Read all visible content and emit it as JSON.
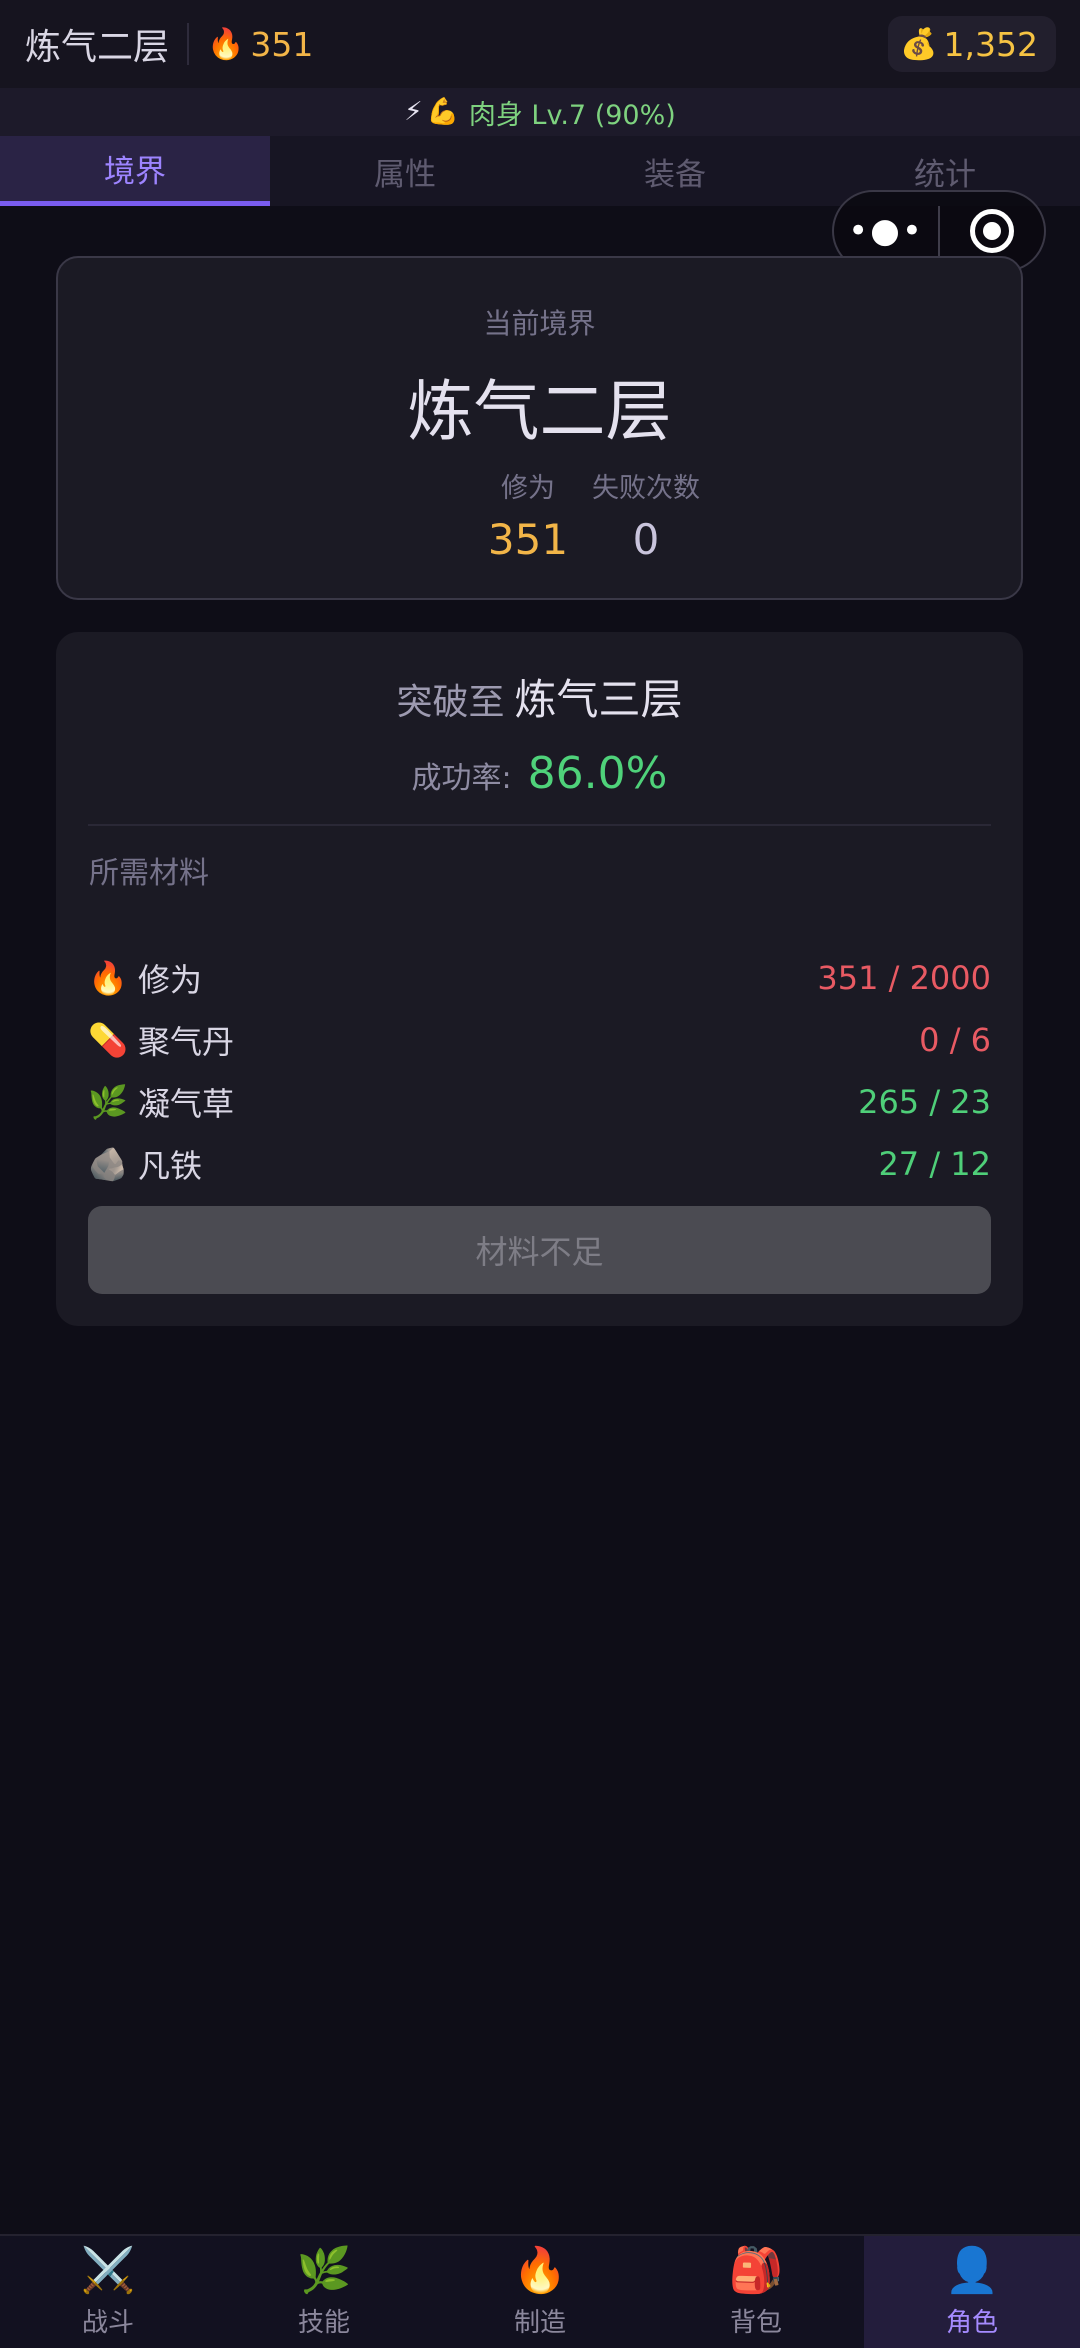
{
  "header": {
    "realm_title": "炼气二层",
    "cultivation_icon": "🔥",
    "cultivation_value": "351",
    "gold_icon": "💰",
    "gold_value": "1,352"
  },
  "status": {
    "icon1": "⚡",
    "icon2": "💪",
    "text": "肉身 Lv.7 (90%)"
  },
  "tabs": [
    {
      "label": "境界",
      "active": true
    },
    {
      "label": "属性",
      "active": false
    },
    {
      "label": "装备",
      "active": false
    },
    {
      "label": "统计",
      "active": false
    }
  ],
  "capsule": {
    "more_glyph": "•●•"
  },
  "realm_card": {
    "label": "当前境界",
    "name": "炼气二层",
    "cultivation_label": "修为",
    "cultivation_value": "351",
    "fail_label": "失败次数",
    "fail_value": "0"
  },
  "breakthrough": {
    "prefix": "突破至",
    "target": "炼气三层",
    "rate_label": "成功率:",
    "rate_value": "86.0%",
    "materials_title": "所需材料",
    "materials": [
      {
        "icon": "🔥",
        "name": "修为",
        "count": "351 / 2000",
        "sufficient": false
      },
      {
        "icon": "💊",
        "name": "聚气丹",
        "count": "0 / 6",
        "sufficient": false
      },
      {
        "icon": "🌿",
        "name": "凝气草",
        "count": "265 / 23",
        "sufficient": true
      },
      {
        "icon": "🪨",
        "name": "凡铁",
        "count": "27 / 12",
        "sufficient": true
      }
    ],
    "button_label": "材料不足"
  },
  "bottom_nav": [
    {
      "icon": "⚔️",
      "label": "战斗",
      "active": false
    },
    {
      "icon": "🌿",
      "label": "技能",
      "active": false
    },
    {
      "icon": "🔥",
      "label": "制造",
      "active": false
    },
    {
      "icon": "🎒",
      "label": "背包",
      "active": false
    },
    {
      "icon": "👤",
      "label": "角色",
      "active": true
    }
  ],
  "colors": {
    "accent": "#7a5cf0",
    "gold": "#f6c343",
    "success": "#4fd27a",
    "danger": "#e85a63"
  }
}
